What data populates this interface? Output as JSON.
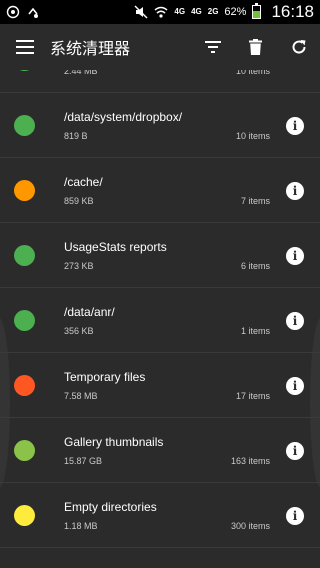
{
  "status_bar": {
    "network_1": "4G",
    "network_2": "4G",
    "network_3": "2G",
    "battery_percent": "62%",
    "battery_level": 0.62,
    "time": "16:18"
  },
  "app_bar": {
    "title": "系统清理器",
    "icons": [
      "menu-icon",
      "filter-icon",
      "trash-icon",
      "refresh-icon"
    ]
  },
  "colors": {
    "green": "#4caf50",
    "orange": "#ff9800",
    "red": "#ff5722",
    "light_green": "#8bc34a",
    "yellow": "#ffeb3b"
  },
  "rows": [
    {
      "title": "",
      "size": "2.44 MB",
      "count": "10 items",
      "color": "#4caf50"
    },
    {
      "title": "/data/system/dropbox/",
      "size": "819 B",
      "count": "10 items",
      "color": "#4caf50"
    },
    {
      "title": "/cache/",
      "size": "859 KB",
      "count": "7 items",
      "color": "#ff9800"
    },
    {
      "title": "UsageStats reports",
      "size": "273 KB",
      "count": "6 items",
      "color": "#4caf50"
    },
    {
      "title": "/data/anr/",
      "size": "356 KB",
      "count": "1 items",
      "color": "#4caf50"
    },
    {
      "title": "Temporary files",
      "size": "7.58 MB",
      "count": "17 items",
      "color": "#ff5722"
    },
    {
      "title": "Gallery thumbnails",
      "size": "15.87 GB",
      "count": "163 items",
      "color": "#8bc34a"
    },
    {
      "title": "Empty directories",
      "size": "1.18 MB",
      "count": "300 items",
      "color": "#ffeb3b"
    }
  ]
}
